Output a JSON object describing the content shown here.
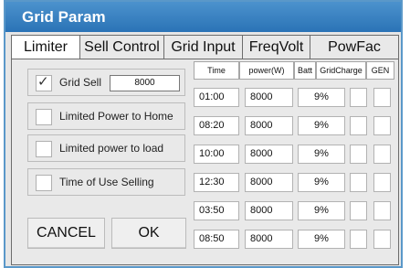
{
  "window": {
    "title": "Grid Param"
  },
  "tabs": [
    {
      "label": "Limiter",
      "active": true
    },
    {
      "label": "Sell Control",
      "active": false
    },
    {
      "label": "Grid Input",
      "active": false
    },
    {
      "label": "FreqVolt",
      "active": false
    },
    {
      "label": "PowFac",
      "active": false
    }
  ],
  "limiter": {
    "grid_sell": {
      "label": "Grid Sell",
      "checked": true,
      "value": "8000"
    },
    "limited_power_to_home": {
      "label": "Limited Power to Home",
      "checked": false
    },
    "limited_power_to_load": {
      "label": "Limited power to load",
      "checked": false
    },
    "time_of_use_selling": {
      "label": "Time of Use Selling",
      "checked": false
    }
  },
  "buttons": {
    "cancel": "CANCEL",
    "ok": "OK"
  },
  "schedule": {
    "headers": {
      "time": "Time",
      "power": "power(W)",
      "batt": "Batt",
      "grid_charge": "GridCharge",
      "gen": "GEN"
    },
    "rows": [
      {
        "time": "01:00",
        "power": "8000",
        "batt": "9%",
        "grid_charge": false,
        "gen": false
      },
      {
        "time": "08:20",
        "power": "8000",
        "batt": "9%",
        "grid_charge": false,
        "gen": false
      },
      {
        "time": "10:00",
        "power": "8000",
        "batt": "9%",
        "grid_charge": false,
        "gen": false
      },
      {
        "time": "12:30",
        "power": "8000",
        "batt": "9%",
        "grid_charge": false,
        "gen": false
      },
      {
        "time": "03:50",
        "power": "8000",
        "batt": "9%",
        "grid_charge": false,
        "gen": false
      },
      {
        "time": "08:50",
        "power": "8000",
        "batt": "9%",
        "grid_charge": false,
        "gen": false
      }
    ]
  },
  "colors": {
    "title_bar": "#3a83c4",
    "window_border": "#5a98c9",
    "panel_bg": "#e9e9e9"
  }
}
